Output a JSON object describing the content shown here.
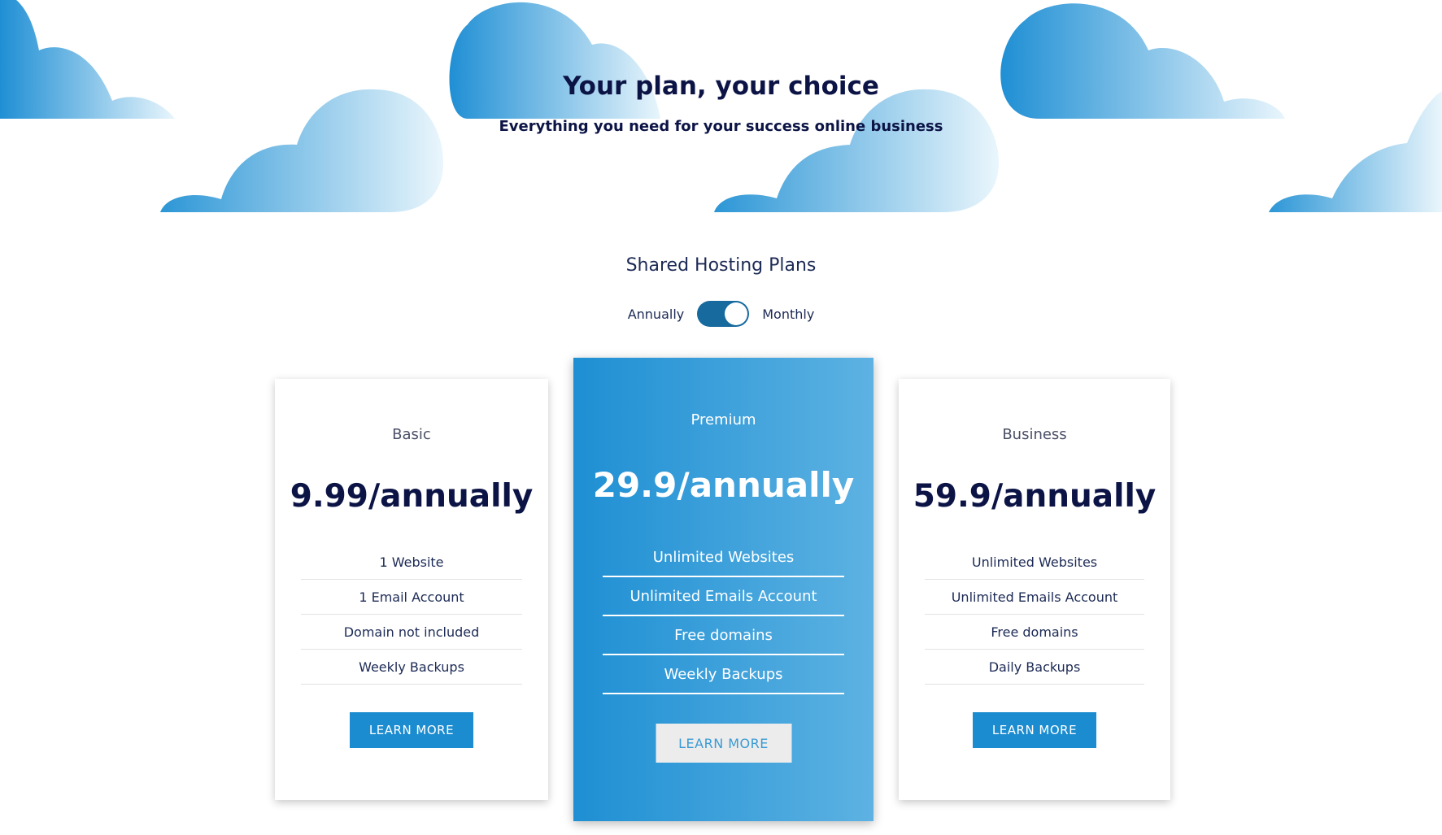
{
  "hero": {
    "title": "Your plan, your choice",
    "subtitle": "Everything you need for your success online business"
  },
  "plans_section": {
    "heading": "Shared Hosting Plans",
    "toggle": {
      "left_label": "Annually",
      "right_label": "Monthly",
      "state": "on"
    }
  },
  "colors": {
    "text_dark": "#0c1446",
    "accent_blue": "#1b8cd0",
    "premium_gradient_start": "#1e8fd3",
    "premium_gradient_end": "#5db2e2",
    "toggle_track": "#166a9e"
  },
  "plans": [
    {
      "name": "Basic",
      "price": "9.99/annually",
      "features": [
        "1 Website",
        "1 Email Account",
        "Domain not included",
        "Weekly Backups"
      ],
      "button": "LEARN MORE",
      "highlighted": false
    },
    {
      "name": "Premium",
      "price": "29.9/annually",
      "features": [
        "Unlimited Websites",
        "Unlimited Emails Account",
        "Free domains",
        "Weekly Backups"
      ],
      "button": "LEARN MORE",
      "highlighted": true
    },
    {
      "name": "Business",
      "price": "59.9/annually",
      "features": [
        "Unlimited Websites",
        "Unlimited Emails Account",
        "Free domains",
        "Daily Backups"
      ],
      "button": "LEARN MORE",
      "highlighted": false
    }
  ]
}
